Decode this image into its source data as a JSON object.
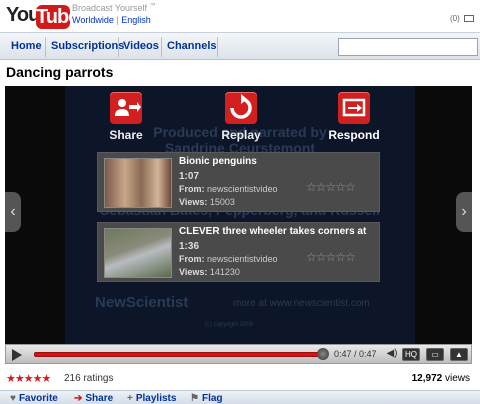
{
  "header": {
    "logo_you": "You",
    "logo_tube": "Tube",
    "tagline": "Broadcast Yourself",
    "tagline_mark": "™",
    "lang_worldwide": "Worldwide",
    "lang_sep": "|",
    "lang_english": "English",
    "mailbox_count": "(0)"
  },
  "nav": {
    "items": [
      "Home",
      "Subscriptions",
      "Videos",
      "Channels"
    ],
    "search_value": ""
  },
  "video": {
    "title": "Dancing parrots",
    "background_text": {
      "line1": "Produced and narrated by",
      "line2": "Sandrine Ceurstemont",
      "line3": "Sebastian Bates, Pepperberg, and Russell",
      "logo": "NewScientist",
      "site": "more at www.newscientist.com",
      "copyright": "(c) copyright 2009"
    },
    "actions": [
      {
        "label": "Share",
        "icon": "share-icon"
      },
      {
        "label": "Replay",
        "icon": "replay-icon"
      },
      {
        "label": "Respond",
        "icon": "respond-icon"
      }
    ],
    "related": [
      {
        "title": "Bionic penguins",
        "duration": "1:07",
        "from_label": "From:",
        "from": "newscientistvideo",
        "views_label": "Views:",
        "views": "15003",
        "stars": "☆☆☆☆☆"
      },
      {
        "title": "CLEVER three wheeler takes corners at",
        "duration": "1:36",
        "from_label": "From:",
        "from": "newscientistvideo",
        "views_label": "Views:",
        "views": "141230",
        "stars": "☆☆☆☆☆"
      }
    ],
    "nav_left": "‹",
    "nav_right": "›"
  },
  "controls": {
    "time": "0:47 / 0:47",
    "progress": 1.0,
    "hq_label": "HQ"
  },
  "stats": {
    "stars": "★★★★★",
    "ratings": "216 ratings",
    "views": "12,972",
    "views_suffix": "views"
  },
  "actionbar": {
    "favorite": "Favorite",
    "share": "Share",
    "playlists": "Playlists",
    "flag": "Flag"
  },
  "colors": {
    "brand_red": "#d21a1a",
    "link_blue": "#003399"
  }
}
